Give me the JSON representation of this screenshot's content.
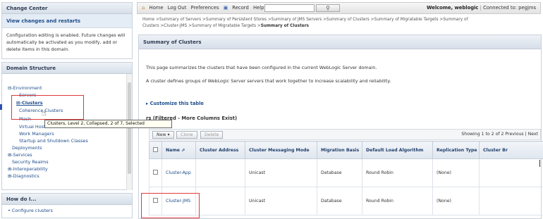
{
  "change_center": {
    "title": "Change Center",
    "link": "View changes and restarts",
    "text": "Configuration editing is enabled. Future changes will automatically be activated as you modify, add or delete items in this domain."
  },
  "domain_structure": {
    "title": "Domain Structure",
    "items": [
      "⊟-Environment",
      "Servers",
      "⊞-Clusters",
      "Coherence Clusters",
      "Mach",
      "Virtual Hosts",
      "Work Managers",
      "Startup and Shutdown Classes",
      "Deployments",
      "⊞-Services",
      "Security Realms",
      "⊞-Interoperability",
      "⊞-Diagnostics"
    ]
  },
  "tooltip": "Clusters, Level 2, Collapsed, 2 of 7, Selected",
  "how_do_i": {
    "title": "How do I...",
    "items": [
      "•  Configure clusters"
    ]
  },
  "topbar": {
    "home": "Home",
    "logout": "Log Out",
    "preferences": "Preferences",
    "record": "Record",
    "help": "Help",
    "welcome_label": "Welcome, weblogic",
    "connected": "Connected to: pegjms"
  },
  "breadcrumb": {
    "line1": "Home >Summary of Servers >Summary of Persistent Stores >Summary of JMS Servers >Summary of Clusters >Summary of Migratable Targets >Summary of",
    "line2_prefix": "Clusters >Cluster-JMS >Summary of Migratable Targets >",
    "line2_current": "Summary of Clusters"
  },
  "main": {
    "title": "Summary of Clusters",
    "desc1": "This page summarizes the clusters that have been configured in the current WebLogic Server domain.",
    "desc2": "A cluster defines groups of WebLogic Server servers that work together to increase scalability and reliability.",
    "customize": "Customize this table",
    "table_title": "rs (Filtered - More Columns Exist)",
    "buttons": {
      "new": "New",
      "clone": "Clone",
      "delete": "Delete"
    },
    "showing": "Showing 1 to 2 of 2   Previous | Next"
  },
  "table": {
    "headers": [
      "Name ⇗",
      "Cluster Address",
      "Cluster Messaging Mode",
      "Migration Basis",
      "Default Load Algorithm",
      "Replication Type",
      "Cluster Br"
    ],
    "rows": [
      [
        "Cluster-App",
        "",
        "Unicast",
        "Database",
        "Round Robin",
        "(None)",
        ""
      ],
      [
        "Cluster-JMS",
        "",
        "Unicast",
        "Database",
        "Round Robin",
        "(None)",
        ""
      ]
    ]
  }
}
